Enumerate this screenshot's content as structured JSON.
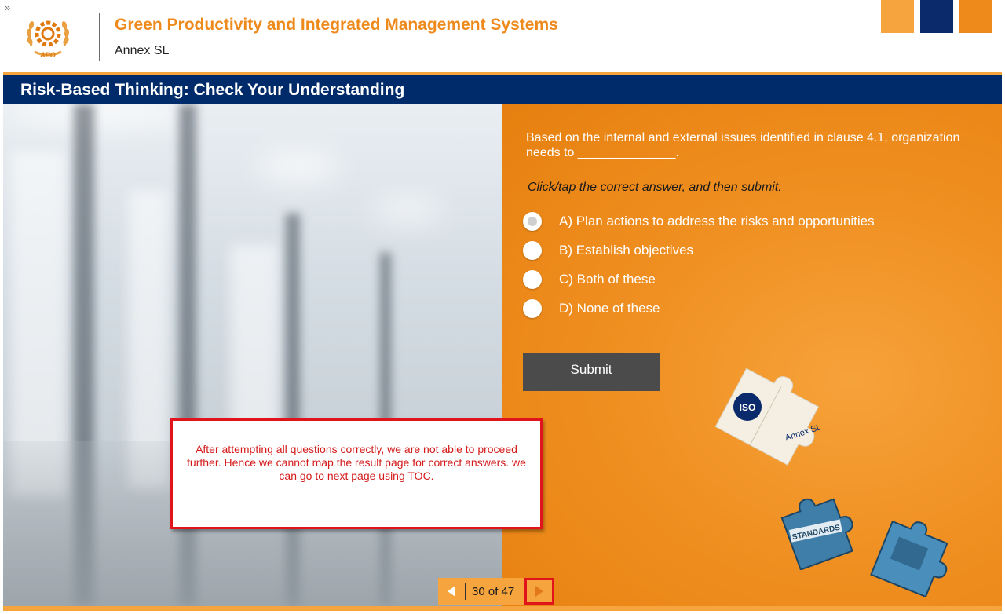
{
  "header": {
    "toc_toggle": "»",
    "course_title": "Green Productivity and Integrated Management Systems",
    "course_subtitle": "Annex SL",
    "logo_text": "APO"
  },
  "slide": {
    "title": "Risk-Based Thinking: Check Your Understanding",
    "question": "Based on the internal and external issues identified in clause 4.1, organization needs to ______________.",
    "instruction": "Click/tap the correct answer, and then submit.",
    "options": [
      {
        "label": "A) Plan actions to address the risks and opportunities",
        "selected": true
      },
      {
        "label": "B) Establish objectives",
        "selected": false
      },
      {
        "label": "C) Both of these",
        "selected": false
      },
      {
        "label": "D)  None of these",
        "selected": false
      }
    ],
    "submit_label": "Submit",
    "puzzle_labels": {
      "iso": "ISO",
      "annex": "Annex SL",
      "standards": "STANDARDS"
    }
  },
  "annotation": {
    "text": "After attempting all questions correctly, we are not able to proceed further. Hence we cannot map the result page for correct answers. we can go to next page using TOC."
  },
  "pager": {
    "count": "30 of 47"
  },
  "colors": {
    "accent_orange": "#ee8a1c",
    "navy": "#002b6b",
    "annotation_red": "#e0141a"
  }
}
